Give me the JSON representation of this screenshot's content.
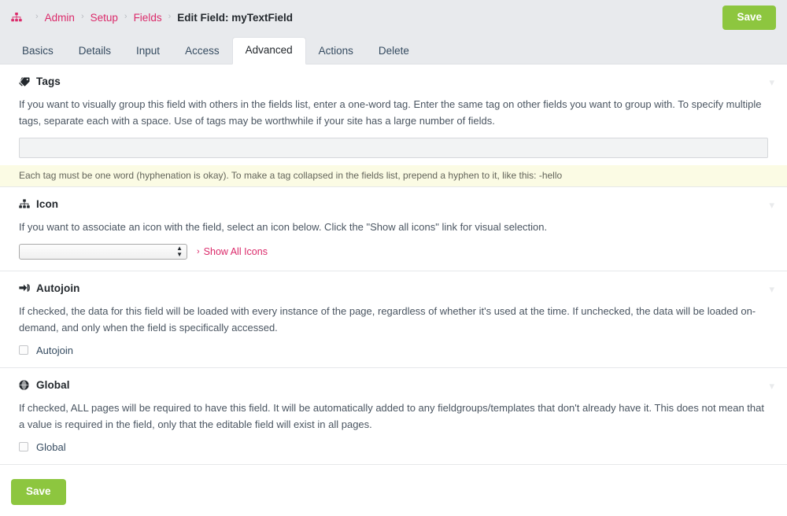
{
  "masthead": {
    "home_icon": "sitemap-icon",
    "breadcrumb": [
      {
        "label": "Admin",
        "link": true
      },
      {
        "label": "Setup",
        "link": true
      },
      {
        "label": "Fields",
        "link": true
      }
    ],
    "separator": "›",
    "current": "Edit Field: myTextField",
    "save_label": "Save"
  },
  "tabs": [
    {
      "label": "Basics",
      "active": false
    },
    {
      "label": "Details",
      "active": false
    },
    {
      "label": "Input",
      "active": false
    },
    {
      "label": "Access",
      "active": false
    },
    {
      "label": "Advanced",
      "active": true
    },
    {
      "label": "Actions",
      "active": false
    },
    {
      "label": "Delete",
      "active": false
    }
  ],
  "sections": {
    "tags": {
      "icon": "tag-icon",
      "title": "Tags",
      "description": "If you want to visually group this field with others in the fields list, enter a one-word tag. Enter the same tag on other fields you want to group with. To specify multiple tags, separate each with a space. Use of tags may be worthwhile if your site has a large number of fields.",
      "input_value": "",
      "input_placeholder": "",
      "notes": "Each tag must be one word (hyphenation is okay). To make a tag collapsed in the fields list, prepend a hyphen to it, like this: -hello",
      "collapse_icon": "chevron-down-icon"
    },
    "icon": {
      "icon": "sitemap-icon",
      "title": "Icon",
      "description": "If you want to associate an icon with the field, select an icon below. Click the \"Show all icons\" link for visual selection.",
      "select_value": "",
      "show_all_label": "Show All Icons",
      "show_all_caret": "›",
      "collapse_icon": "chevron-down-icon"
    },
    "autojoin": {
      "icon": "sign-in-icon",
      "title": "Autojoin",
      "description": "If checked, the data for this field will be loaded with every instance of the page, regardless of whether it's used at the time. If unchecked, the data will be loaded on-demand, and only when the field is specifically accessed.",
      "checkbox_label": "Autojoin",
      "checked": false,
      "collapse_icon": "chevron-down-icon"
    },
    "global": {
      "icon": "globe-icon",
      "title": "Global",
      "description": "If checked, ALL pages will be required to have this field. It will be automatically added to any fieldgroups/templates that don't already have it. This does not mean that a value is required in the field, only that the editable field will exist in all pages.",
      "checkbox_label": "Global",
      "checked": false,
      "collapse_icon": "chevron-down-icon"
    }
  },
  "footer": {
    "save_label": "Save"
  },
  "colors": {
    "accent_pink": "#db2a6a",
    "save_green": "#8dc63f",
    "masthead_bg": "#e8eaed",
    "notes_bg": "#fbfbe4"
  }
}
